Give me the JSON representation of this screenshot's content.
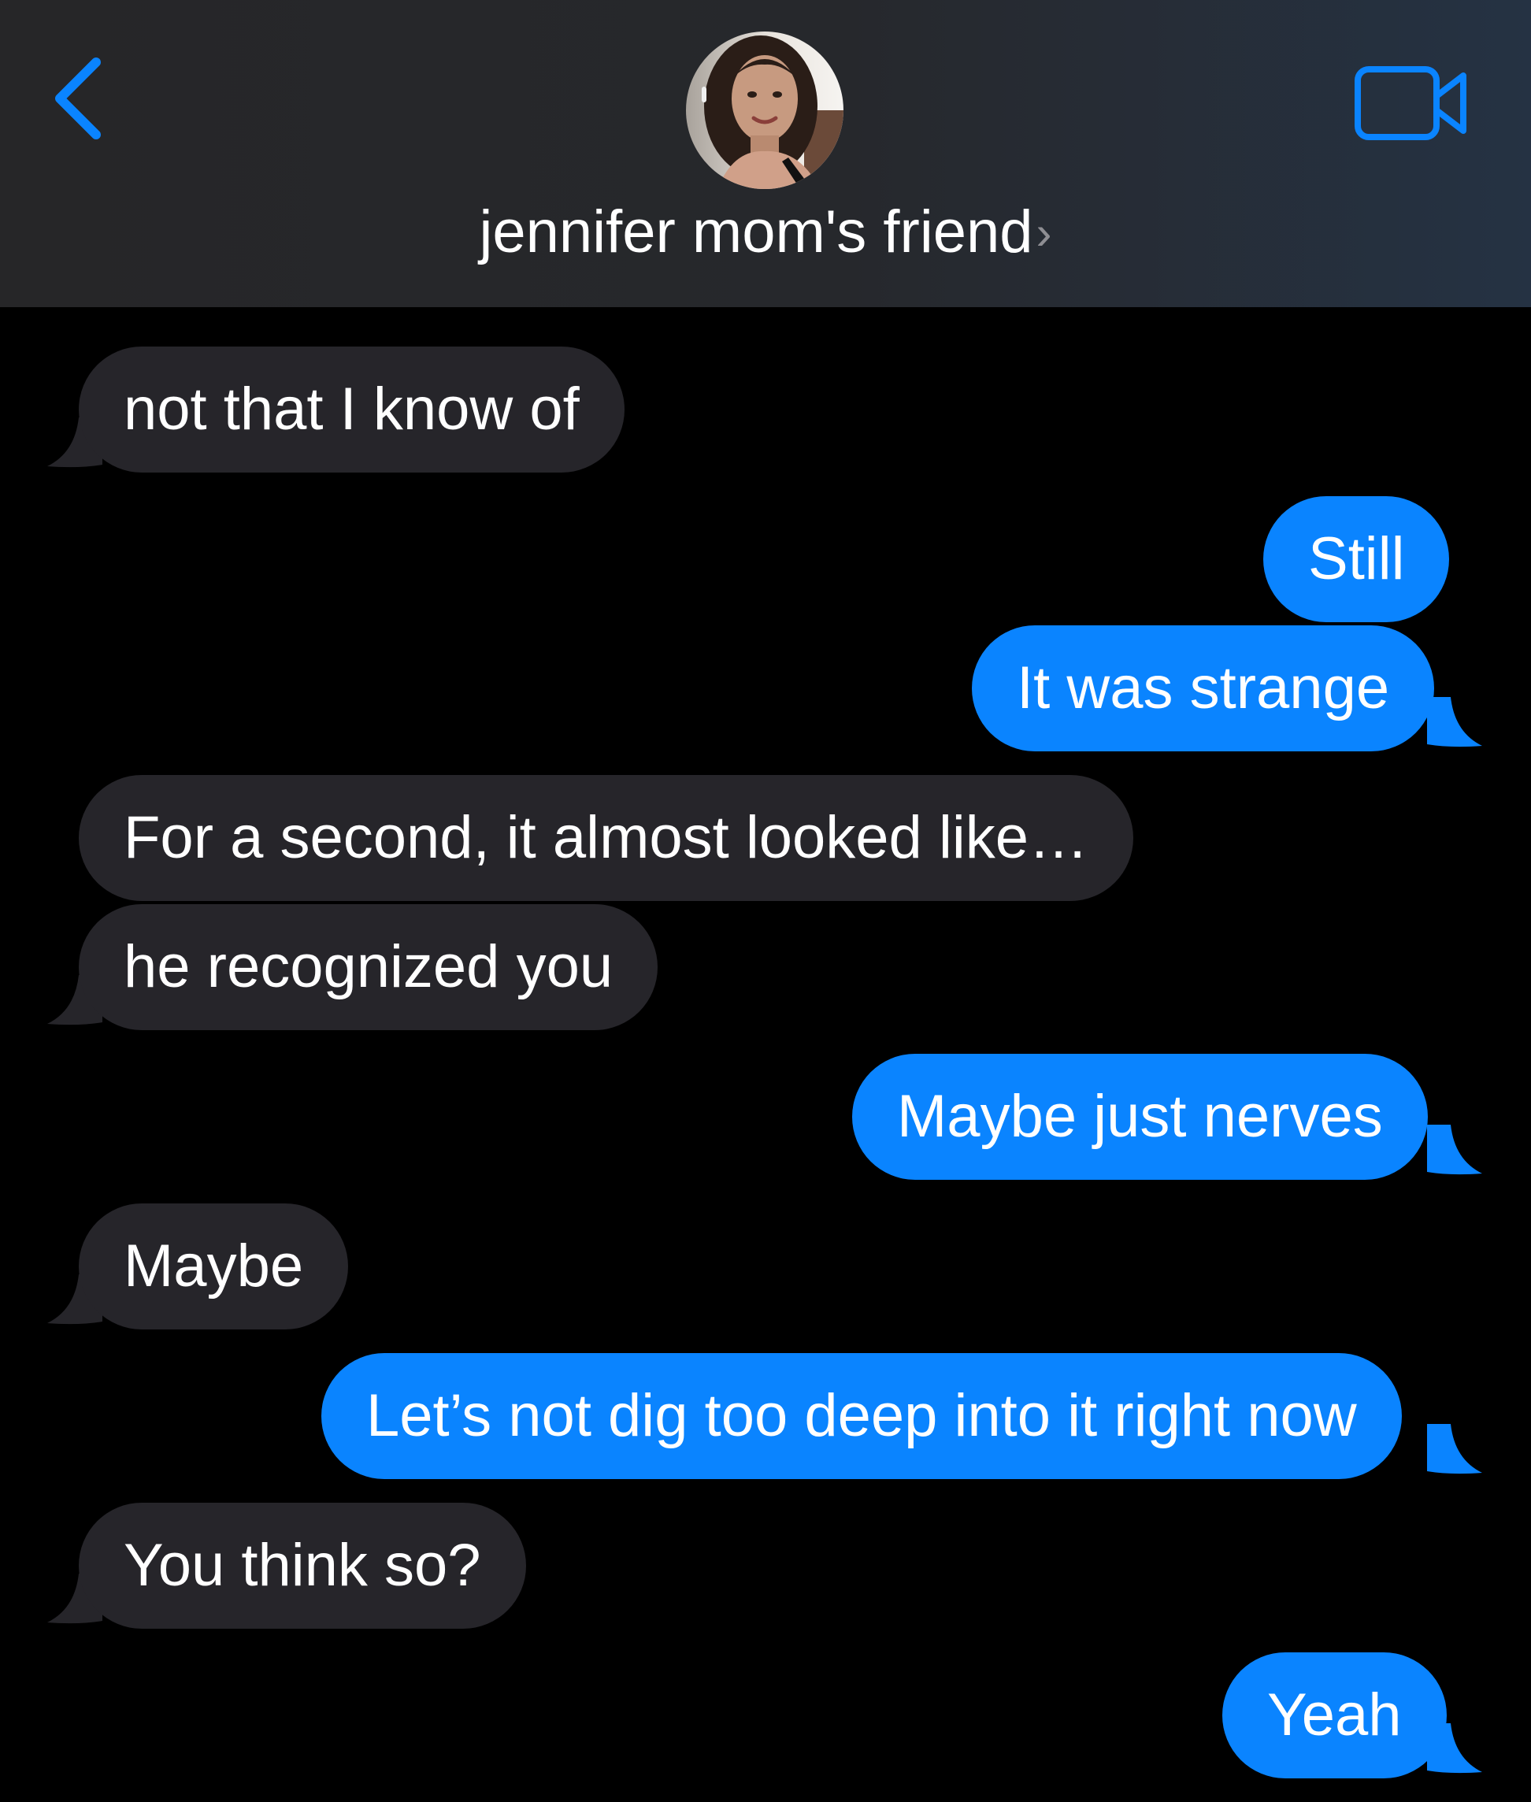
{
  "header": {
    "contact_name": "jennifer mom's friend",
    "chevron": "›",
    "back_icon": "chevron-left-icon",
    "video_icon": "video-camera-icon",
    "accent_color": "#0a84ff"
  },
  "colors": {
    "incoming_bubble": "#26252a",
    "outgoing_bubble": "#0a84ff",
    "background": "#000000"
  },
  "messages": [
    {
      "from": "them",
      "text": "not that I know of"
    },
    {
      "from": "me",
      "text": "Still"
    },
    {
      "from": "me",
      "text": "It was strange"
    },
    {
      "from": "them",
      "text": "For a second, it almost looked like…"
    },
    {
      "from": "them",
      "text": "he recognized you"
    },
    {
      "from": "me",
      "text": "Maybe just nerves"
    },
    {
      "from": "them",
      "text": "Maybe"
    },
    {
      "from": "me",
      "text": "Let’s not dig too deep into it right now"
    },
    {
      "from": "them",
      "text": "You think so?"
    },
    {
      "from": "me",
      "text": "Yeah"
    }
  ]
}
